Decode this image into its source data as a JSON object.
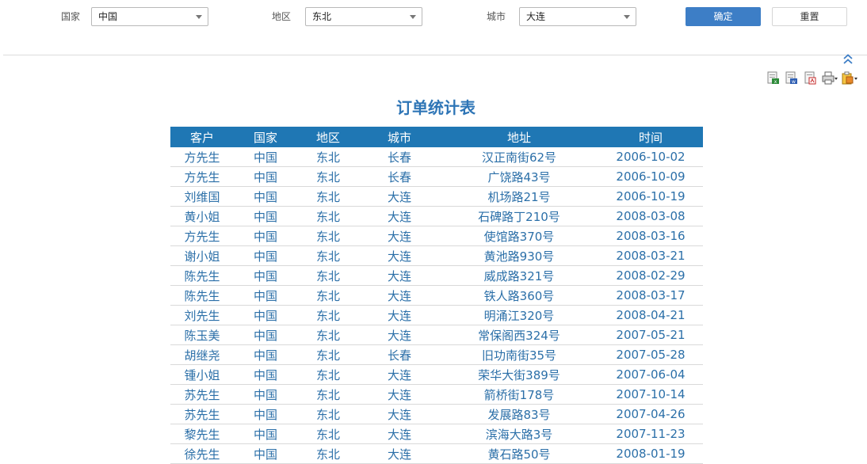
{
  "filters": {
    "country": {
      "label": "国家",
      "value": "中国"
    },
    "region": {
      "label": "地区",
      "value": "东北"
    },
    "city": {
      "label": "城市",
      "value": "大连"
    },
    "confirm_label": "确定",
    "reset_label": "重置"
  },
  "toolbar": {
    "icons": [
      "export-excel-icon",
      "export-word-icon",
      "export-pdf-icon",
      "print-icon",
      "share-icon"
    ]
  },
  "colors": {
    "primary": "#3d7ec6",
    "table_header": "#1f77b4",
    "title": "#2e75b6",
    "cell_text": "#2b6fa8"
  },
  "report": {
    "title": "订单统计表",
    "columns": [
      "客户",
      "国家",
      "地区",
      "城市",
      "地址",
      "时间"
    ],
    "rows": [
      [
        "方先生",
        "中国",
        "东北",
        "长春",
        "汉正南街62号",
        "2006-10-02"
      ],
      [
        "方先生",
        "中国",
        "东北",
        "长春",
        "广饶路43号",
        "2006-10-09"
      ],
      [
        "刘维国",
        "中国",
        "东北",
        "大连",
        "机场路21号",
        "2006-10-19"
      ],
      [
        "黄小姐",
        "中国",
        "东北",
        "大连",
        "石碑路丁210号",
        "2008-03-08"
      ],
      [
        "方先生",
        "中国",
        "东北",
        "大连",
        "使馆路370号",
        "2008-03-16"
      ],
      [
        "谢小姐",
        "中国",
        "东北",
        "大连",
        "黄池路930号",
        "2008-03-21"
      ],
      [
        "陈先生",
        "中国",
        "东北",
        "大连",
        "威成路321号",
        "2008-02-29"
      ],
      [
        "陈先生",
        "中国",
        "东北",
        "大连",
        "铁人路360号",
        "2008-03-17"
      ],
      [
        "刘先生",
        "中国",
        "东北",
        "大连",
        "明涌江320号",
        "2008-04-21"
      ],
      [
        "陈玉美",
        "中国",
        "东北",
        "大连",
        "常保阁西324号",
        "2007-05-21"
      ],
      [
        "胡继尧",
        "中国",
        "东北",
        "长春",
        "旧功南街35号",
        "2007-05-28"
      ],
      [
        "锺小姐",
        "中国",
        "东北",
        "大连",
        "荣华大街389号",
        "2007-06-04"
      ],
      [
        "苏先生",
        "中国",
        "东北",
        "大连",
        "箭桥街178号",
        "2007-10-14"
      ],
      [
        "苏先生",
        "中国",
        "东北",
        "大连",
        "发展路83号",
        "2007-04-26"
      ],
      [
        "黎先生",
        "中国",
        "东北",
        "大连",
        "滨海大路3号",
        "2007-11-23"
      ],
      [
        "徐先生",
        "中国",
        "东北",
        "大连",
        "黄石路50号",
        "2008-01-19"
      ]
    ]
  }
}
